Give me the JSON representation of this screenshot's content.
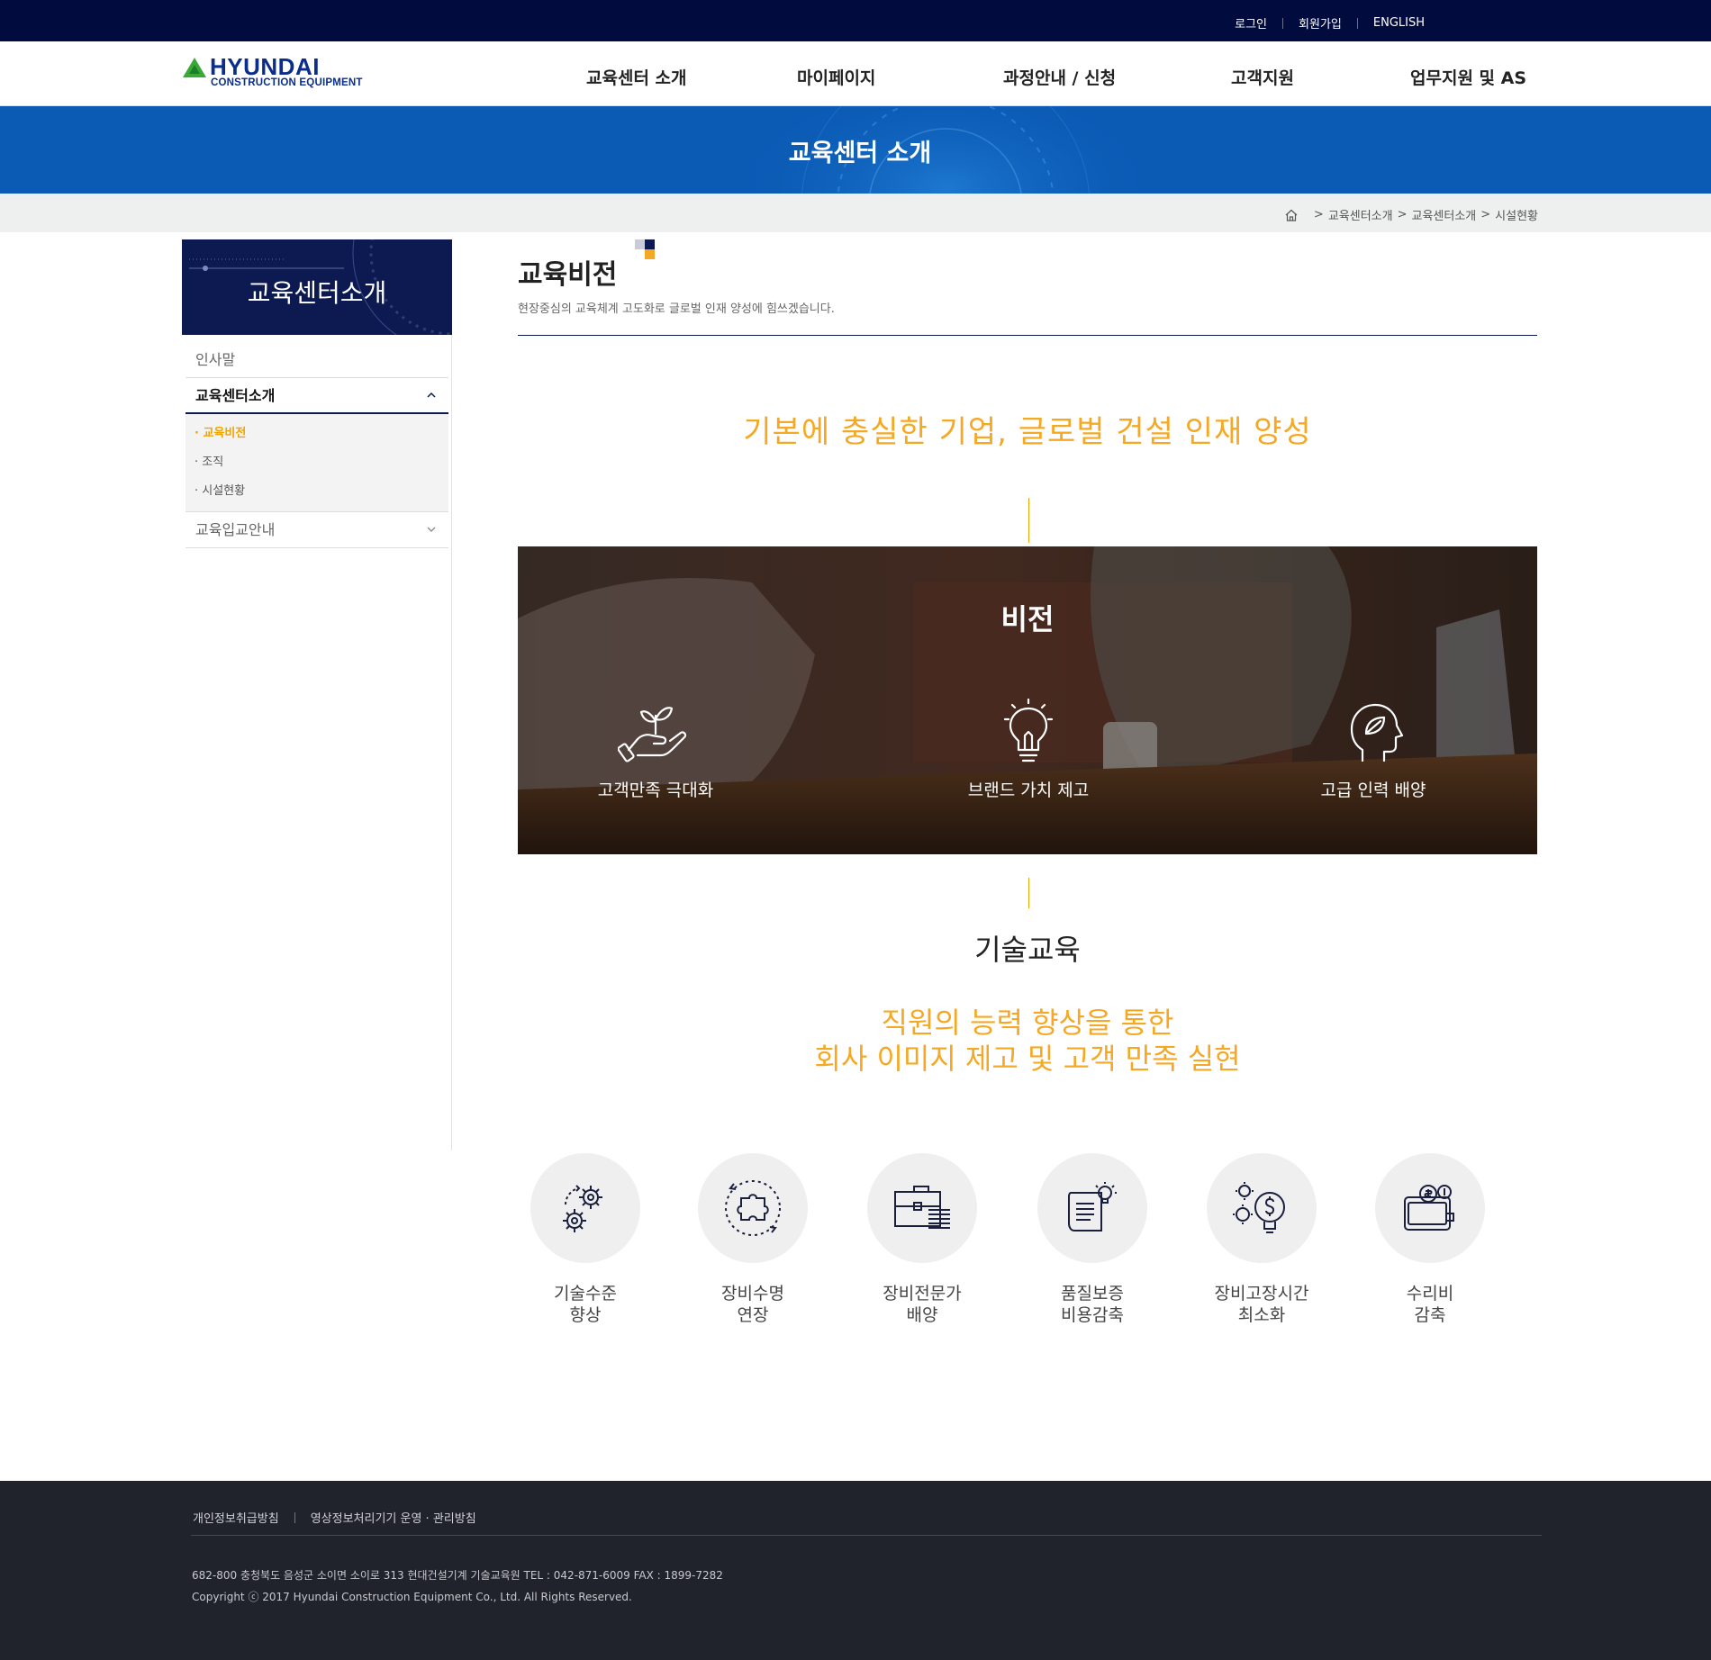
{
  "top_utility": {
    "login": "로그인",
    "join": "회원가입",
    "english": "ENGLISH"
  },
  "logo": {
    "word": "HYUNDAI",
    "sub": "CONSTRUCTION EQUIPMENT"
  },
  "gnb": [
    {
      "label": "교육센터 소개"
    },
    {
      "label": "마이페이지"
    },
    {
      "label": "과정안내 / 신청"
    },
    {
      "label": "고객지원"
    },
    {
      "label": "업무지원 및 AS"
    }
  ],
  "banner": {
    "title": "교육센터 소개"
  },
  "breadcrumb": {
    "home_icon": "home-icon",
    "items": [
      "교육센터소개",
      "교육센터소개",
      "시설현황"
    ]
  },
  "sidebar": {
    "title": "교육센터소개",
    "items": [
      {
        "label": "인사말"
      },
      {
        "label": "교육센터소개"
      },
      {
        "label": "교육입교안내"
      }
    ],
    "sub_items": [
      {
        "label": "· 교육비전"
      },
      {
        "label": "· 조직"
      },
      {
        "label": "· 시설현황"
      }
    ]
  },
  "content": {
    "title": "교육비전",
    "description": "현장중심의 교육체계 고도화로 글로벌 인재 양성에 힘쓰겠습니다.",
    "slogan": "기본에 충실한 기업, 글로벌 건설 인재 양성",
    "vision": {
      "title": "비전",
      "items": [
        {
          "label": "고객만족 극대화",
          "icon": "plant-hand-icon"
        },
        {
          "label": "브랜드 가치 제고",
          "icon": "lightbulb-icon"
        },
        {
          "label": "고급 인력 배양",
          "icon": "head-leaf-icon"
        }
      ]
    },
    "tech": {
      "title": "기술교육",
      "desc_line1": "직원의 능력 향상을 통한",
      "desc_line2": "회사 이미지 제고 및 고객 만족 실현"
    },
    "benefits": [
      {
        "line1": "기술수준",
        "line2": "향상",
        "icon": "gears-icon"
      },
      {
        "line1": "장비수명",
        "line2": "연장",
        "icon": "puzzle-icon"
      },
      {
        "line1": "장비전문가",
        "line2": "배양",
        "icon": "briefcase-icon"
      },
      {
        "line1": "품질보증",
        "line2": "비용감축",
        "icon": "document-idea-icon"
      },
      {
        "line1": "장비고장시간",
        "line2": "최소화",
        "icon": "gear-bulb-dollar-icon"
      },
      {
        "line1": "수리비",
        "line2": "감축",
        "icon": "wallet-coins-icon"
      }
    ]
  },
  "footer": {
    "privacy": "개인정보취급방침",
    "cctv": "영상정보처리기기 운영 · 관리방침",
    "address": "682-800  충청북도 음성군 소이면 소이로 313 현대건설기계 기술교육원 TEL : 042-871-6009 FAX : 1899-7282",
    "copyright": "Copyright ⓒ 2017 Hyundai Construction Equipment Co., Ltd. All Rights Reserved."
  },
  "colors": {
    "navy": "#020b3e",
    "banner_blue": "#0b5bb5",
    "accent_orange": "#f5a823",
    "footer_bg": "#20232b"
  }
}
